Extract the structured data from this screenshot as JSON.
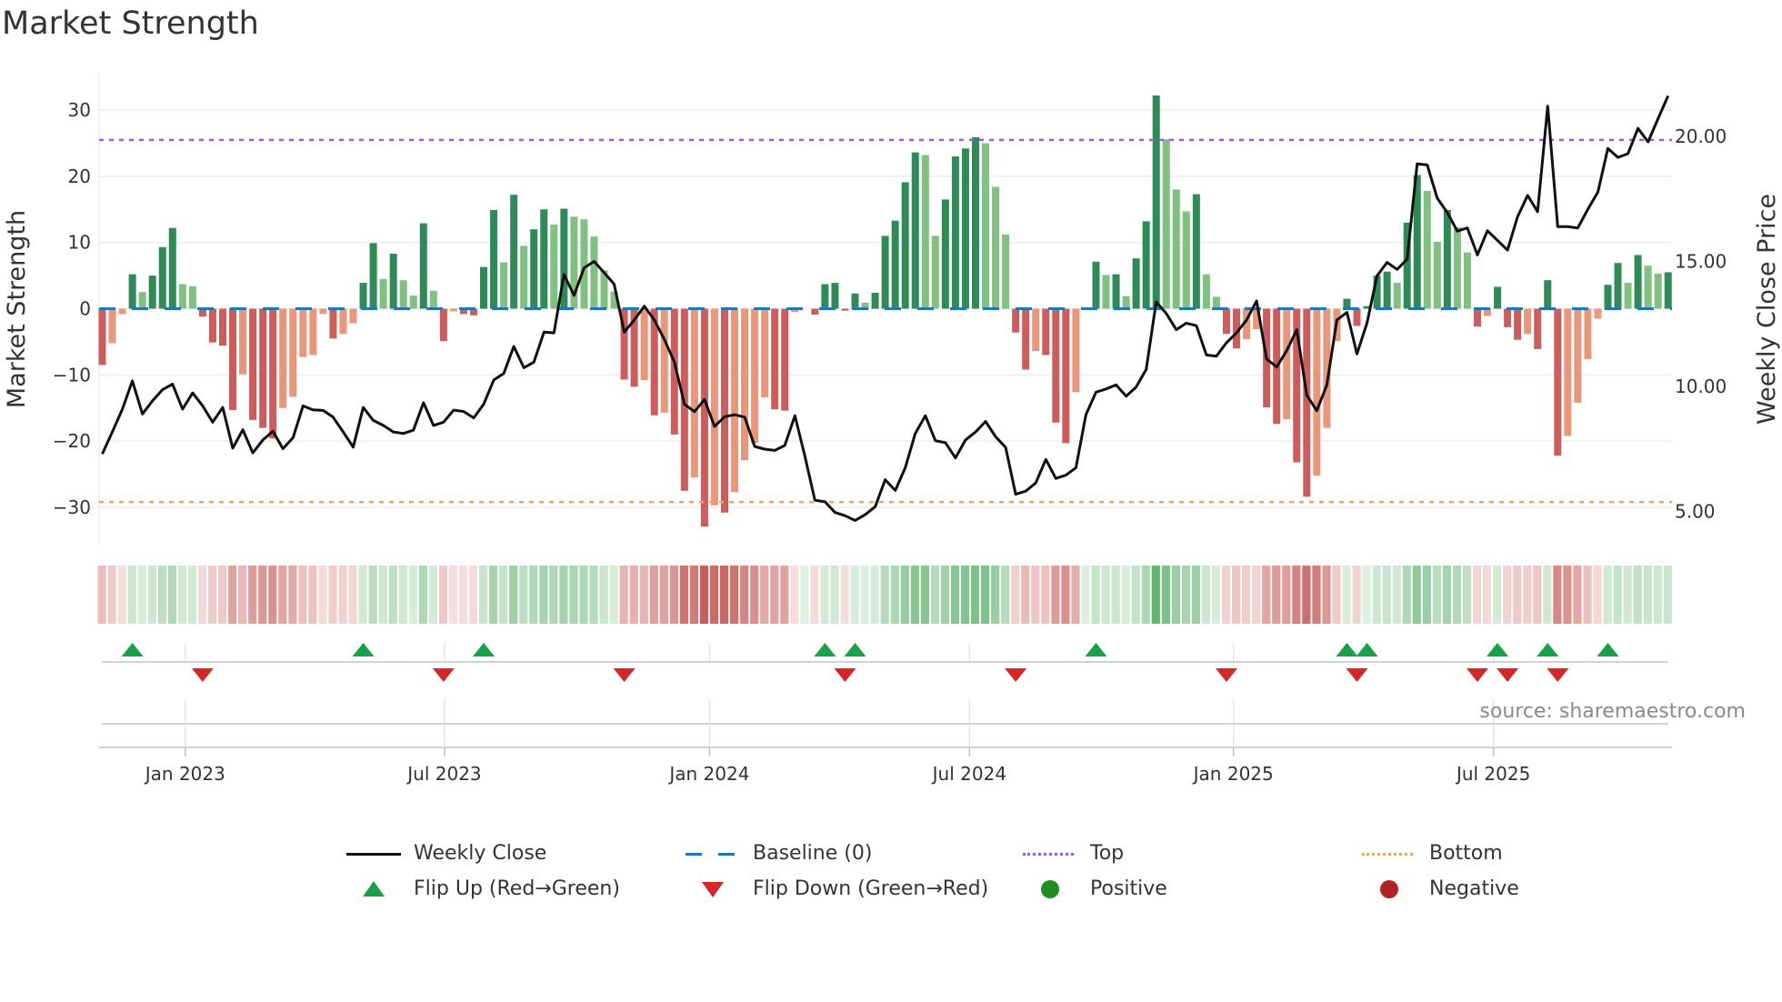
{
  "title": "Market Strength",
  "source": "source: sharemaestro.com",
  "colors": {
    "pos_strong": "#2e8b57",
    "pos_weak": "#80c080",
    "neg_strong": "#cd5c5c",
    "neg_weak": "#e9967a",
    "baseline": "#1f77b4",
    "top": "#9b5de5",
    "bottom": "#f4a261",
    "flip_up": "#18a04a",
    "flip_down": "#d62728",
    "positive": "#228b22",
    "negative": "#b22222",
    "line": "#111111"
  },
  "legend": {
    "weekly_close": "Weekly Close",
    "baseline": "Baseline (0)",
    "top": "Top",
    "bottom": "Bottom",
    "flip_up": "Flip Up (Red→Green)",
    "flip_down": "Flip Down (Green→Red)",
    "positive": "Positive",
    "negative": "Negative"
  },
  "chart_data": {
    "type": "bar+line",
    "title": "Market Strength",
    "ylabel": "Market Strength",
    "y2label": "Weekly Close Price",
    "ylim": [
      -35.5,
      35.5
    ],
    "y2lim": [
      3.7,
      22.5
    ],
    "yticks": [
      30,
      20,
      10,
      0,
      -10,
      -20,
      -30
    ],
    "y2ticks": [
      "20.00",
      "15.00",
      "10.00",
      "5.00"
    ],
    "y2tick_values": [
      20,
      15,
      10,
      5
    ],
    "top_level": 25.5,
    "bottom_level": -29.2,
    "baseline": 0,
    "x_unit": "week index",
    "xticks": [
      {
        "label": "Jan 2023",
        "week": 8.27
      },
      {
        "label": "Jul 2023",
        "week": 34.1
      },
      {
        "label": "Jan 2024",
        "week": 60.5
      },
      {
        "label": "Jul 2024",
        "week": 86.4
      },
      {
        "label": "Jan 2025",
        "week": 112.7
      },
      {
        "label": "Jul 2025",
        "week": 138.6
      }
    ],
    "strength": [
      -8.5,
      -5.2,
      -0.8,
      5.2,
      2.5,
      5.0,
      9.3,
      12.2,
      3.7,
      3.4,
      -1.2,
      -5.1,
      -5.6,
      -15.3,
      -9.9,
      -16.8,
      -18.0,
      -19.6,
      -15.0,
      -13.3,
      -7.3,
      -7.0,
      -0.8,
      -4.5,
      -3.8,
      -2.2,
      3.9,
      9.9,
      4.5,
      8.3,
      4.3,
      2.0,
      12.9,
      2.7,
      -4.9,
      -0.4,
      -0.8,
      -1.0,
      6.3,
      14.9,
      7.0,
      17.2,
      9.5,
      12.0,
      15.0,
      12.7,
      15.1,
      13.9,
      13.5,
      10.9,
      5.8,
      2.6,
      -10.7,
      -11.8,
      -10.8,
      -16.1,
      -15.7,
      -19.0,
      -27.5,
      -25.5,
      -32.9,
      -29.7,
      -30.8,
      -27.7,
      -22.9,
      -20.3,
      -13.4,
      -15.2,
      -15.4,
      -0.5,
      0,
      -0.9,
      3.7,
      3.9,
      -0.3,
      2.3,
      0.9,
      2.4,
      11.0,
      13.3,
      19.1,
      23.6,
      23.2,
      11.0,
      16.5,
      23.0,
      24.2,
      25.9,
      25.0,
      18.4,
      11.2,
      -3.6,
      -9.2,
      -6.4,
      -7.0,
      -17.2,
      -20.3,
      -12.6,
      0,
      7.1,
      5.1,
      5.2,
      1.9,
      7.6,
      13.2,
      32.2,
      25.6,
      18.0,
      14.7,
      17.3,
      5.2,
      1.8,
      -3.8,
      -6.0,
      -4.6,
      -3.1,
      -14.9,
      -17.4,
      -16.7,
      -23.2,
      -28.4,
      -25.2,
      -18.0,
      -4.9,
      1.5,
      -2.6,
      0.4,
      5.0,
      5.6,
      3.9,
      13.0,
      20.2,
      17.8,
      10.1,
      14.9,
      12.3,
      8.5,
      -2.7,
      -1.1,
      3.3,
      -2.8,
      -4.7,
      -3.8,
      -6.1,
      4.3,
      -22.2,
      -19.2,
      -14.2,
      -7.6,
      -1.5,
      3.6,
      6.9,
      3.9,
      8.1,
      6.5,
      5.3,
      5.5
    ],
    "weekly_close": [
      7.3,
      8.18,
      9.09,
      10.22,
      8.9,
      9.42,
      9.87,
      10.09,
      9.09,
      9.74,
      9.22,
      8.57,
      9.16,
      7.53,
      8.27,
      7.34,
      7.86,
      8.21,
      7.51,
      7.95,
      9.22,
      9.06,
      9.04,
      8.77,
      8.18,
      7.57,
      9.16,
      8.64,
      8.44,
      8.18,
      8.12,
      8.25,
      9.35,
      8.44,
      8.57,
      9.05,
      9.0,
      8.74,
      9.29,
      10.26,
      10.52,
      11.6,
      10.75,
      10.97,
      12.17,
      12.14,
      14.48,
      13.64,
      14.74,
      15.0,
      14.55,
      14.09,
      12.17,
      12.66,
      13.21,
      12.66,
      11.88,
      10.97,
      9.29,
      8.99,
      9.48,
      8.4,
      8.79,
      8.87,
      8.77,
      7.6,
      7.49,
      7.44,
      7.64,
      8.83,
      7.21,
      5.45,
      5.39,
      4.96,
      4.83,
      4.64,
      4.87,
      5.19,
      6.27,
      5.84,
      6.75,
      8.12,
      8.83,
      7.83,
      7.75,
      7.14,
      7.86,
      8.18,
      8.6,
      7.99,
      7.56,
      5.69,
      5.81,
      6.14,
      7.08,
      6.32,
      6.45,
      6.75,
      8.87,
      9.77,
      9.9,
      10.06,
      9.61,
      9.97,
      10.68,
      13.38,
      12.92,
      12.27,
      12.53,
      12.43,
      11.26,
      11.21,
      11.75,
      12.14,
      12.66,
      13.42,
      11.1,
      10.78,
      11.43,
      12.27,
      9.65,
      9.03,
      10.06,
      12.66,
      12.96,
      11.3,
      12.53,
      14.42,
      14.96,
      14.68,
      15.09,
      18.9,
      18.86,
      17.53,
      16.95,
      16.21,
      16.34,
      15.26,
      16.23,
      15.84,
      15.45,
      16.78,
      17.64,
      16.99,
      21.21,
      16.39,
      16.39,
      16.34,
      17.08,
      17.77,
      19.52,
      19.16,
      19.31,
      20.32,
      19.78,
      20.71,
      21.62
    ],
    "flip_up_weeks": [
      4,
      27,
      39,
      73,
      76,
      100,
      125,
      127,
      140,
      145,
      151
    ],
    "flip_down_weeks": [
      11,
      35,
      53,
      75,
      92,
      113,
      126,
      138,
      141,
      146
    ],
    "grid": true,
    "legend_placement": "bottom"
  }
}
